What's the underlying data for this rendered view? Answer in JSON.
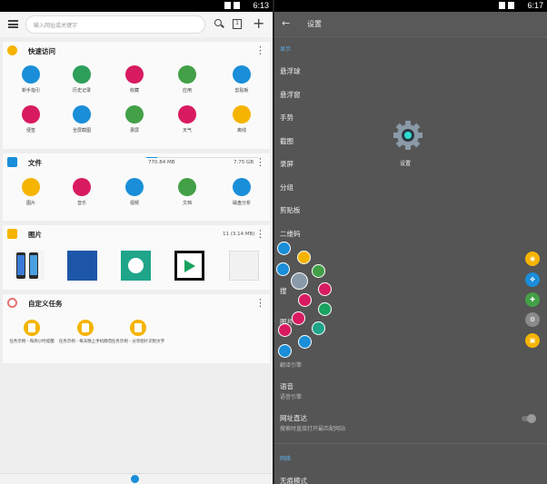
{
  "left": {
    "status_time": "6:13",
    "search_placeholder": "输入网址或关键字",
    "tabs_count": "1",
    "quick_access": {
      "title": "快速访问",
      "items": [
        {
          "label": "新手指引",
          "color": "#1a8ed8",
          "icon": "hand-icon"
        },
        {
          "label": "历史记录",
          "color": "#2e9e5b",
          "icon": "history-icon"
        },
        {
          "label": "收藏",
          "color": "#d81b60",
          "icon": "star-icon"
        },
        {
          "label": "应用",
          "color": "#43a047",
          "icon": "android-icon"
        },
        {
          "label": "剪贴板",
          "color": "#1a8ed8",
          "icon": "clipboard-icon"
        },
        {
          "label": "便签",
          "color": "#d81b60",
          "icon": "note-icon"
        },
        {
          "label": "全屏截图",
          "color": "#1a8ed8",
          "icon": "screenshot-icon"
        },
        {
          "label": "录屏",
          "color": "#43a047",
          "icon": "record-icon"
        },
        {
          "label": "天气",
          "color": "#d81b60",
          "icon": "sun-icon"
        },
        {
          "label": "离线",
          "color": "#f5b400",
          "icon": "offline-icon"
        }
      ]
    },
    "files": {
      "title": "文件",
      "used": "770.84 MB",
      "total": "7.75 GB",
      "usage_fraction": 0.1,
      "items": [
        {
          "label": "图片",
          "color": "#f5b400",
          "icon": "image-icon"
        },
        {
          "label": "音乐",
          "color": "#d81b60",
          "icon": "music-icon"
        },
        {
          "label": "视频",
          "color": "#1a8ed8",
          "icon": "video-icon"
        },
        {
          "label": "文档",
          "color": "#43a047",
          "icon": "document-icon"
        },
        {
          "label": "磁盘分析",
          "color": "#1a8ed8",
          "icon": "disk-icon"
        }
      ]
    },
    "pictures": {
      "title": "图片",
      "count": "11 (3.14 MB)"
    },
    "tasks": {
      "title": "自定义任务",
      "items": [
        {
          "label": "任务示例 - 每周小时提醒"
        },
        {
          "label": "任务示例 - 每天晚上手机静音"
        },
        {
          "label": "任务示例 - 分享图片识别文字"
        }
      ]
    }
  },
  "right": {
    "status_time": "6:17",
    "title": "设置",
    "section_display": "显示",
    "items": [
      "悬浮球",
      "悬浮窗",
      "手势",
      "截图",
      "录屏",
      "分组",
      "剪贴板",
      "二维码"
    ],
    "partial_a": "搜",
    "partial_b": "图片",
    "voice_sub_above": "翻译引擎",
    "voice_title": "语音",
    "voice_sub": "语音引擎",
    "url_title": "网址直达",
    "url_sub": "搜索时直接打开最匹配网站",
    "section_network": "网络",
    "incognito": "无痕模式",
    "gear_label": "设置"
  }
}
